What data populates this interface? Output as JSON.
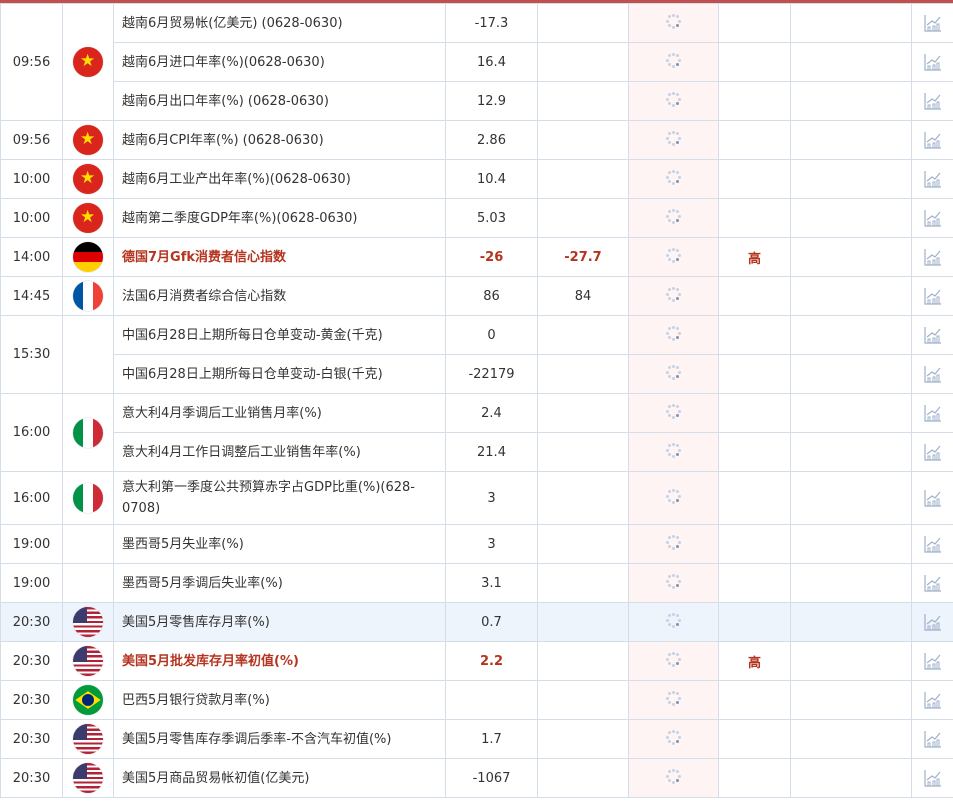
{
  "colors": {
    "accent": "#c0504d",
    "important": "#b5341f",
    "actual_bg": "#fff4f4",
    "highlight": "#eef4fc"
  },
  "groups": [
    {
      "time": "09:56",
      "flag": "vietnam",
      "rows": [
        {
          "event": "越南6月贸易帐(亿美元) (0628-0630)",
          "previous": "-17.3",
          "forecast": "",
          "importance": ""
        },
        {
          "event": "越南6月进口年率(%)(0628-0630)",
          "previous": "16.4",
          "forecast": "",
          "importance": ""
        },
        {
          "event": "越南6月出口年率(%) (0628-0630)",
          "previous": "12.9",
          "forecast": "",
          "importance": ""
        }
      ]
    },
    {
      "time": "09:56",
      "flag": "vietnam",
      "rows": [
        {
          "event": "越南6月CPI年率(%) (0628-0630)",
          "previous": "2.86",
          "forecast": "",
          "importance": ""
        }
      ]
    },
    {
      "time": "10:00",
      "flag": "vietnam",
      "rows": [
        {
          "event": "越南6月工业产出年率(%)(0628-0630)",
          "previous": "10.4",
          "forecast": "",
          "importance": ""
        }
      ]
    },
    {
      "time": "10:00",
      "flag": "vietnam",
      "rows": [
        {
          "event": "越南第二季度GDP年率(%)(0628-0630)",
          "previous": "5.03",
          "forecast": "",
          "importance": ""
        }
      ]
    },
    {
      "time": "14:00",
      "flag": "germany",
      "rows": [
        {
          "event": "德国7月Gfk消费者信心指数",
          "previous": "-26",
          "forecast": "-27.7",
          "importance": "高",
          "important": true
        }
      ]
    },
    {
      "time": "14:45",
      "flag": "france",
      "rows": [
        {
          "event": "法国6月消费者综合信心指数",
          "previous": "86",
          "forecast": "84",
          "importance": ""
        }
      ]
    },
    {
      "time": "15:30",
      "flag": "",
      "rows": [
        {
          "event": "中国6月28日上期所每日仓单变动-黄金(千克)",
          "previous": "0",
          "forecast": "",
          "importance": ""
        },
        {
          "event": "中国6月28日上期所每日仓单变动-白银(千克)",
          "previous": "-22179",
          "forecast": "",
          "importance": ""
        }
      ]
    },
    {
      "time": "16:00",
      "flag": "italy",
      "rows": [
        {
          "event": "意大利4月季调后工业销售月率(%)",
          "previous": "2.4",
          "forecast": "",
          "importance": ""
        },
        {
          "event": "意大利4月工作日调整后工业销售年率(%)",
          "previous": "21.4",
          "forecast": "",
          "importance": ""
        }
      ]
    },
    {
      "time": "16:00",
      "flag": "italy",
      "rows": [
        {
          "event": "意大利第一季度公共预算赤字占GDP比重(%)(628-0708)",
          "previous": "3",
          "forecast": "",
          "importance": "",
          "tall": true
        }
      ]
    },
    {
      "time": "19:00",
      "flag": "",
      "rows": [
        {
          "event": "墨西哥5月失业率(%)",
          "previous": "3",
          "forecast": "",
          "importance": ""
        }
      ]
    },
    {
      "time": "19:00",
      "flag": "",
      "rows": [
        {
          "event": "墨西哥5月季调后失业率(%)",
          "previous": "3.1",
          "forecast": "",
          "importance": ""
        }
      ]
    },
    {
      "time": "20:30",
      "flag": "usa",
      "rows": [
        {
          "event": "美国5月零售库存月率(%)",
          "previous": "0.7",
          "forecast": "",
          "importance": "",
          "highlight": true
        }
      ]
    },
    {
      "time": "20:30",
      "flag": "usa",
      "rows": [
        {
          "event": "美国5月批发库存月率初值(%)",
          "previous": "2.2",
          "forecast": "",
          "importance": "高",
          "important": true
        }
      ]
    },
    {
      "time": "20:30",
      "flag": "brazil",
      "rows": [
        {
          "event": "巴西5月银行贷款月率(%)",
          "previous": "",
          "forecast": "",
          "importance": ""
        }
      ]
    },
    {
      "time": "20:30",
      "flag": "usa",
      "rows": [
        {
          "event": "美国5月零售库存季调后季率-不含汽车初值(%)",
          "previous": "1.7",
          "forecast": "",
          "importance": ""
        }
      ]
    },
    {
      "time": "20:30",
      "flag": "usa",
      "rows": [
        {
          "event": "美国5月商品贸易帐初值(亿美元)",
          "previous": "-1067",
          "forecast": "",
          "importance": ""
        }
      ]
    }
  ]
}
